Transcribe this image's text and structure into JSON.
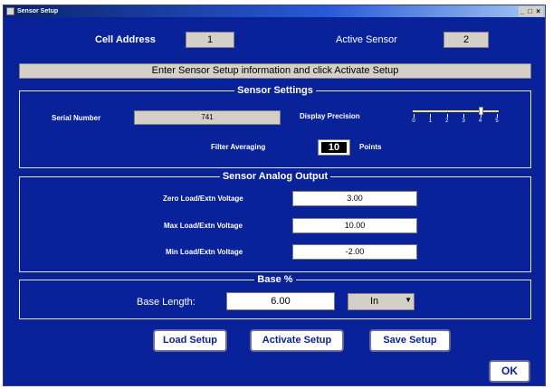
{
  "window": {
    "title": "Sensor Setup",
    "controls": "_ □ ×"
  },
  "header": {
    "cell_address_label": "Cell Address",
    "cell_address_value": "1",
    "active_sensor_label": "Active Sensor",
    "active_sensor_value": "2",
    "instruction": "Enter Sensor Setup information and click Activate Setup"
  },
  "sensor_settings": {
    "title": "Sensor Settings",
    "serial_number_label": "Serial Number",
    "serial_number_value": "741",
    "display_precision_label": "Display Precision",
    "precision_ticks": [
      "0",
      "1",
      "2",
      "3",
      "4",
      "5"
    ],
    "precision_value": 4,
    "filter_averaging_label": "Filter Averaging",
    "filter_averaging_value": "10",
    "points_label": "Points"
  },
  "analog_output": {
    "title": "Sensor Analog Output",
    "zero_label": "Zero Load/Extn Voltage",
    "zero_value": "3.00",
    "max_label": "Max Load/Extn Voltage",
    "max_value": "10.00",
    "min_label": "Min Load/Extn Voltage",
    "min_value": "-2.00"
  },
  "base": {
    "title": "Base %",
    "base_length_label": "Base Length:",
    "base_length_value": "6.00",
    "unit_value": "In",
    "unit_arrow": "▼"
  },
  "buttons": {
    "load": "Load Setup",
    "activate": "Activate Setup",
    "save": "Save Setup",
    "ok": "OK"
  }
}
